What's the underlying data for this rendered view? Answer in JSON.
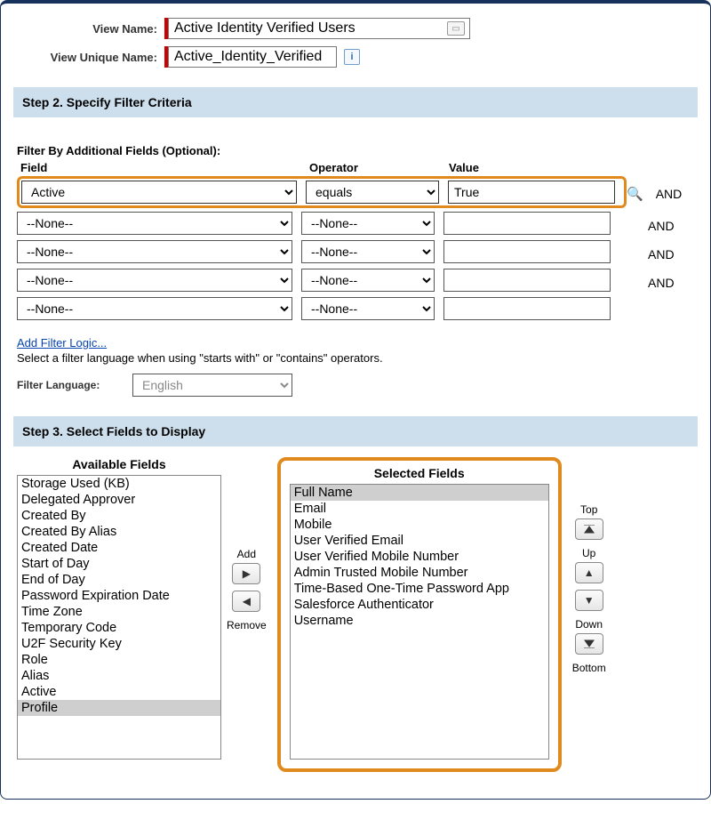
{
  "nameSection": {
    "viewNameLabel": "View Name:",
    "viewNameValue": "Active Identity Verified Users",
    "uniqueNameLabel": "View Unique Name:",
    "uniqueNameValue": "Active_Identity_Verified"
  },
  "step2": {
    "header": "Step 2. Specify Filter Criteria",
    "filterByTitle": "Filter By Additional Fields (Optional):",
    "cols": {
      "field": "Field",
      "operator": "Operator",
      "value": "Value"
    },
    "andLabel": "AND",
    "rows": [
      {
        "field": "Active",
        "operator": "equals",
        "value": "True",
        "highlight": true,
        "showAnd": true,
        "showLookup": true
      },
      {
        "field": "--None--",
        "operator": "--None--",
        "value": "",
        "highlight": false,
        "showAnd": true,
        "showLookup": false
      },
      {
        "field": "--None--",
        "operator": "--None--",
        "value": "",
        "highlight": false,
        "showAnd": true,
        "showLookup": false
      },
      {
        "field": "--None--",
        "operator": "--None--",
        "value": "",
        "highlight": false,
        "showAnd": true,
        "showLookup": false
      },
      {
        "field": "--None--",
        "operator": "--None--",
        "value": "",
        "highlight": false,
        "showAnd": false,
        "showLookup": false
      }
    ],
    "addFilterLogic": "Add Filter Logic...",
    "filterHint": "Select a filter language when using \"starts with\" or \"contains\" operators.",
    "filterLanguageLabel": "Filter Language:",
    "filterLanguageValue": "English"
  },
  "step3": {
    "header": "Step 3. Select Fields to Display",
    "availableTitle": "Available Fields",
    "selectedTitle": "Selected Fields",
    "available": [
      "Storage Used (KB)",
      "Delegated Approver",
      "Created By",
      "Created By Alias",
      "Created Date",
      "Start of Day",
      "End of Day",
      "Password Expiration Date",
      "Time Zone",
      "Temporary Code",
      "U2F Security Key",
      "Role",
      "Alias",
      "Active",
      "Profile"
    ],
    "availableSelected": "Profile",
    "selected": [
      "Full Name",
      "Email",
      "Mobile",
      "User Verified Email",
      "User Verified Mobile Number",
      "Admin Trusted Mobile Number",
      "Time-Based One-Time Password App",
      "Salesforce Authenticator",
      "Username"
    ],
    "selectedSelected": "Full Name",
    "buttons": {
      "add": "Add",
      "remove": "Remove",
      "top": "Top",
      "up": "Up",
      "down": "Down",
      "bottom": "Bottom"
    }
  }
}
